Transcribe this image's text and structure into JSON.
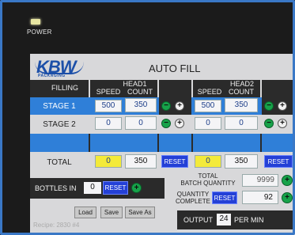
{
  "device": {
    "power_label": "POWER"
  },
  "logo": {
    "text": "KBW",
    "subtext": "PACKAGING"
  },
  "screen": {
    "title": "AUTO FILL"
  },
  "grid": {
    "filling_label": "FILLING",
    "head1_label": "HEAD1",
    "head2_label": "HEAD2",
    "speed_label": "SPEED",
    "count_label": "COUNT",
    "stage1_label": "STAGE 1",
    "stage2_label": "STAGE 2",
    "total_label": "TOTAL",
    "head1": {
      "stage1_speed": "500",
      "stage1_count": "350",
      "stage2_speed": "0",
      "stage2_count": "0",
      "total_speed": "0",
      "total_count": "350"
    },
    "head2": {
      "stage1_speed": "500",
      "stage1_count": "350",
      "stage2_speed": "0",
      "stage2_count": "0",
      "total_speed": "0",
      "total_count": "350"
    },
    "reset_label": "RESET"
  },
  "batch": {
    "total_batch_label": "TOTAL\nBATCH QUANTITY",
    "total_batch_value": "9999",
    "quantity_complete_label": "QUANTITY\nCOMPLETE",
    "quantity_complete_value": "92",
    "reset_label": "RESET"
  },
  "bottles": {
    "label": "BOTTLES IN",
    "value": "0",
    "reset_label": "RESET"
  },
  "actions": {
    "load": "Load",
    "save": "Save",
    "save_as": "Save As"
  },
  "recipe": {
    "text": "Recipe: 2830 #4"
  },
  "output": {
    "label": "OUTPUT",
    "value": "24",
    "unit": "PER MIN"
  },
  "colors": {
    "accent_blue": "#2f7fd8",
    "reset_blue": "#2440d6",
    "yellow": "#f3ea3a",
    "green": "#17a34a"
  },
  "icons": [
    "minus-circle-icon",
    "plus-circle-icon"
  ]
}
